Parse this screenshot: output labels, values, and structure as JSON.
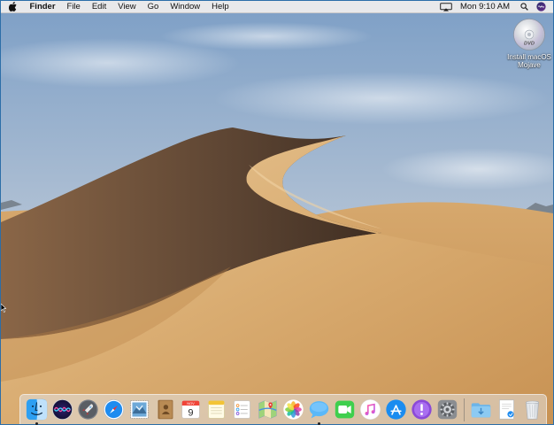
{
  "menubar": {
    "apple_icon": "apple-logo-icon",
    "app_name": "Finder",
    "menus": [
      "File",
      "Edit",
      "View",
      "Go",
      "Window",
      "Help"
    ],
    "status": {
      "airplay_icon": "airplay-icon",
      "clock": "Mon 9:10 AM",
      "spotlight_icon": "search-icon",
      "siri_icon": "siri-icon"
    }
  },
  "desktop": {
    "icons": [
      {
        "label_line1": "Install macOS",
        "label_line2": "Mojave",
        "icon": "dvd-disc-icon"
      }
    ]
  },
  "dock": {
    "apps": [
      {
        "name": "Finder",
        "icon": "finder-icon",
        "running": true
      },
      {
        "name": "Siri",
        "icon": "siri-icon",
        "running": false
      },
      {
        "name": "Launchpad",
        "icon": "launchpad-rocket-icon",
        "running": false
      },
      {
        "name": "Safari",
        "icon": "safari-compass-icon",
        "running": false
      },
      {
        "name": "Mail",
        "icon": "mail-stamp-icon",
        "running": false
      },
      {
        "name": "Contacts",
        "icon": "contacts-book-icon",
        "running": false
      },
      {
        "name": "Calendar",
        "icon": "calendar-icon",
        "running": false,
        "month": "NOV",
        "day": "9"
      },
      {
        "name": "Notes",
        "icon": "notes-icon",
        "running": false
      },
      {
        "name": "Reminders",
        "icon": "reminders-icon",
        "running": false
      },
      {
        "name": "Maps",
        "icon": "maps-icon",
        "running": false
      },
      {
        "name": "Photos",
        "icon": "photos-flower-icon",
        "running": false
      },
      {
        "name": "Messages",
        "icon": "messages-bubble-icon",
        "running": true
      },
      {
        "name": "FaceTime",
        "icon": "facetime-camera-icon",
        "running": false
      },
      {
        "name": "iTunes",
        "icon": "itunes-music-icon",
        "running": false
      },
      {
        "name": "App Store",
        "icon": "app-store-icon",
        "running": false
      },
      {
        "name": "Feedback Assistant",
        "icon": "feedback-exclamation-icon",
        "running": false
      },
      {
        "name": "System Preferences",
        "icon": "gear-icon",
        "running": false
      }
    ],
    "stacks": [
      {
        "name": "Downloads",
        "icon": "downloads-folder-icon"
      },
      {
        "name": "Document",
        "icon": "document-stack-icon"
      },
      {
        "name": "Trash",
        "icon": "trash-icon"
      }
    ]
  },
  "colors": {
    "menubar_bg": "#ececec",
    "sky_top": "#7fa3c9",
    "sky_bottom": "#d9dfe6",
    "sand_light": "#e4bf8c",
    "sand_shadow": "#5f4632",
    "selection_border": "#2c6ea8"
  }
}
